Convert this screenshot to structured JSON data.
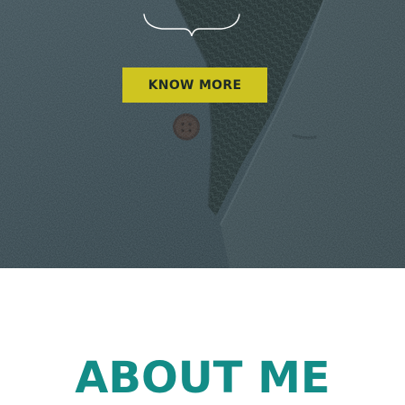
{
  "hero": {
    "ornament_icon": "curly-brace-divider-icon",
    "button_label": "KNOW MORE",
    "colors": {
      "background": "#2f3f46",
      "button_bg": "#cfc520",
      "button_text": "#1e2a26"
    }
  },
  "about": {
    "title": "ABOUT ME",
    "title_color": "#138c87"
  }
}
